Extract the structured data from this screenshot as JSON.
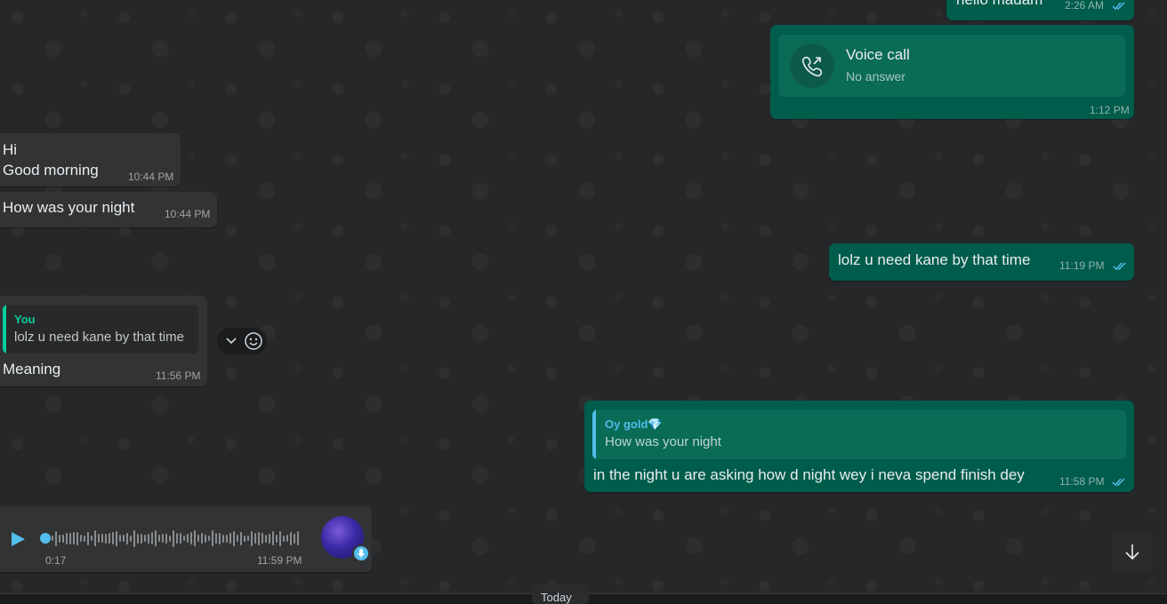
{
  "colors": {
    "incoming_bubble": "#323334",
    "outgoing_bubble": "#005c4b",
    "read_ticks": "#53bdeb",
    "quote_you": "#06cf9c",
    "quote_contact": "#53bdeb",
    "play": "#53bdeb"
  },
  "messages": {
    "m1": {
      "text": "hello madam",
      "time": "2:26 AM",
      "status": "read"
    },
    "m2": {
      "title": "Voice call",
      "subtitle": "No answer",
      "time": "1:12 PM",
      "icon": "phone-outgoing-icon"
    },
    "m3": {
      "line1": "Hi",
      "line2": "Good morning",
      "time": "10:44 PM"
    },
    "m4": {
      "text": "How was your night",
      "time": "10:44 PM"
    },
    "m5": {
      "text": "lolz u need kane by that time",
      "time": "11:19 PM",
      "status": "read"
    },
    "m6": {
      "quote_name": "You",
      "quote_text": "lolz u need kane by that time",
      "text": "Meaning",
      "time": "11:56 PM"
    },
    "m7": {
      "quote_name": "Oy gold💎",
      "quote_text": "How was your night",
      "text": "in the night u are asking how d night wey i neva spend finish dey",
      "time": "11:58 PM",
      "status": "read"
    },
    "m8": {
      "type": "voice",
      "duration": "0:17",
      "time": "11:59 PM",
      "progress": 0
    }
  },
  "reaction_bar": {
    "icons": [
      "chevron-down-icon",
      "emoji-icon"
    ]
  },
  "scroll_button": {
    "icon": "arrow-down-icon"
  },
  "date_chip": {
    "text": "Today"
  }
}
